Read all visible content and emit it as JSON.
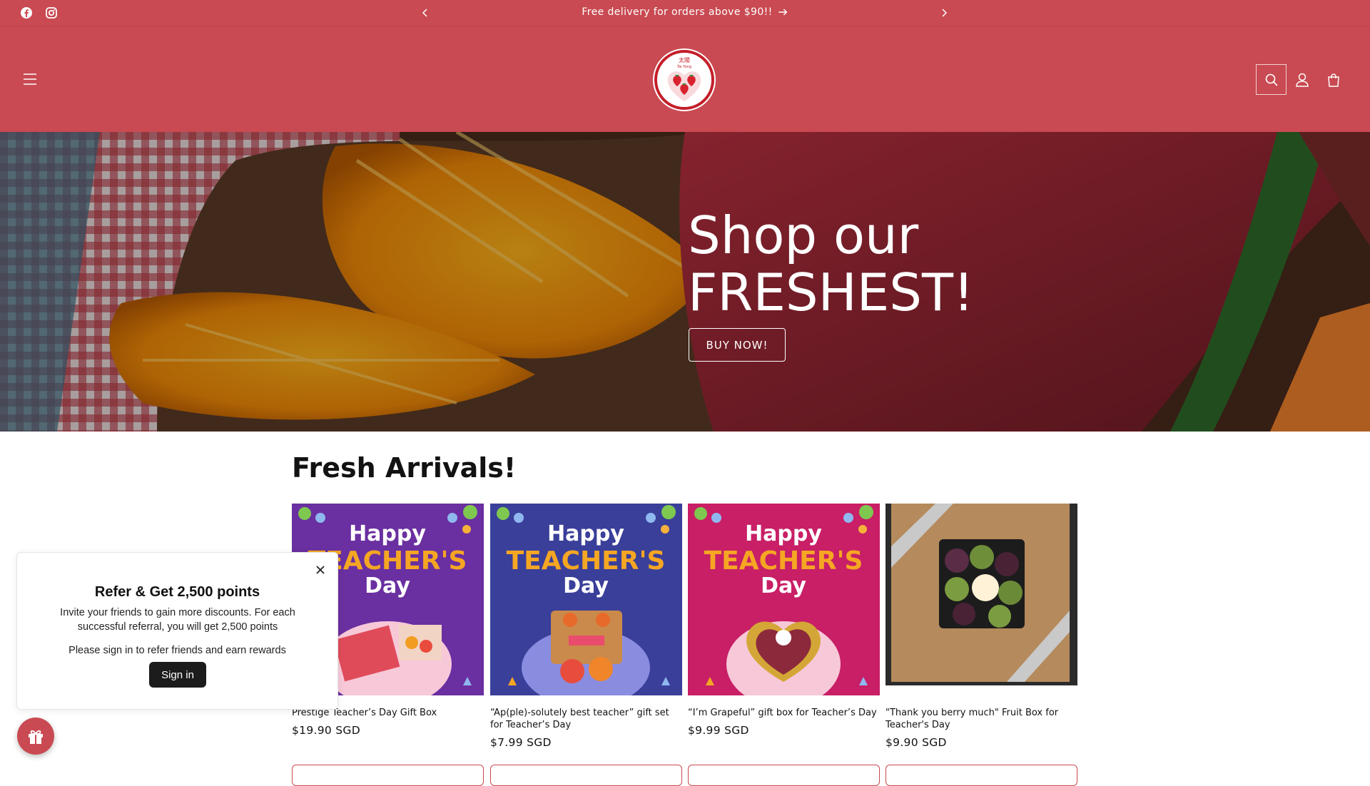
{
  "announcement": {
    "text": "Free delivery for orders above $90!!",
    "social_icons": [
      "facebook-icon",
      "instagram-icon"
    ]
  },
  "header": {
    "logo_alt": "Tai Yong",
    "icons": [
      "menu-icon",
      "search-icon",
      "account-icon",
      "cart-icon"
    ]
  },
  "hero": {
    "title_line1": "Shop our",
    "title_line2": "FRESHEST!",
    "button_label": "BUY NOW!"
  },
  "products": {
    "section_title": "Fresh Arrivals!",
    "items": [
      {
        "name": "Prestige Teacher’s Day Gift Box",
        "price": "$19.90 SGD",
        "bg": "#6a2fa0"
      },
      {
        "name": "“Ap(ple)-solutely best teacher” gift set for Teacher’s Day",
        "price": "$7.99 SGD",
        "bg": "#3a3f9a"
      },
      {
        "name": "“I’m Grapeful” gift box for Teacher’s Day",
        "price": "$9.99 SGD",
        "bg": "#c81f66"
      },
      {
        "name": "\"Thank you berry much\" Fruit Box for Teacher's Day",
        "price": "$9.90 SGD",
        "bg": "#2a2a2a"
      }
    ],
    "image_text": {
      "happy": "Happy",
      "teachers": "TEACHER'S",
      "day": "Day"
    }
  },
  "referral_popup": {
    "title": "Refer & Get 2,500 points",
    "description": "Invite your friends to gain more discounts. For each successful referral, you will get 2,500 points",
    "note": "Please sign in to refer friends and earn rewards",
    "button_label": "Sign in"
  },
  "colors": {
    "brand": "#c94a52",
    "dark_button": "#1c1c1c"
  }
}
